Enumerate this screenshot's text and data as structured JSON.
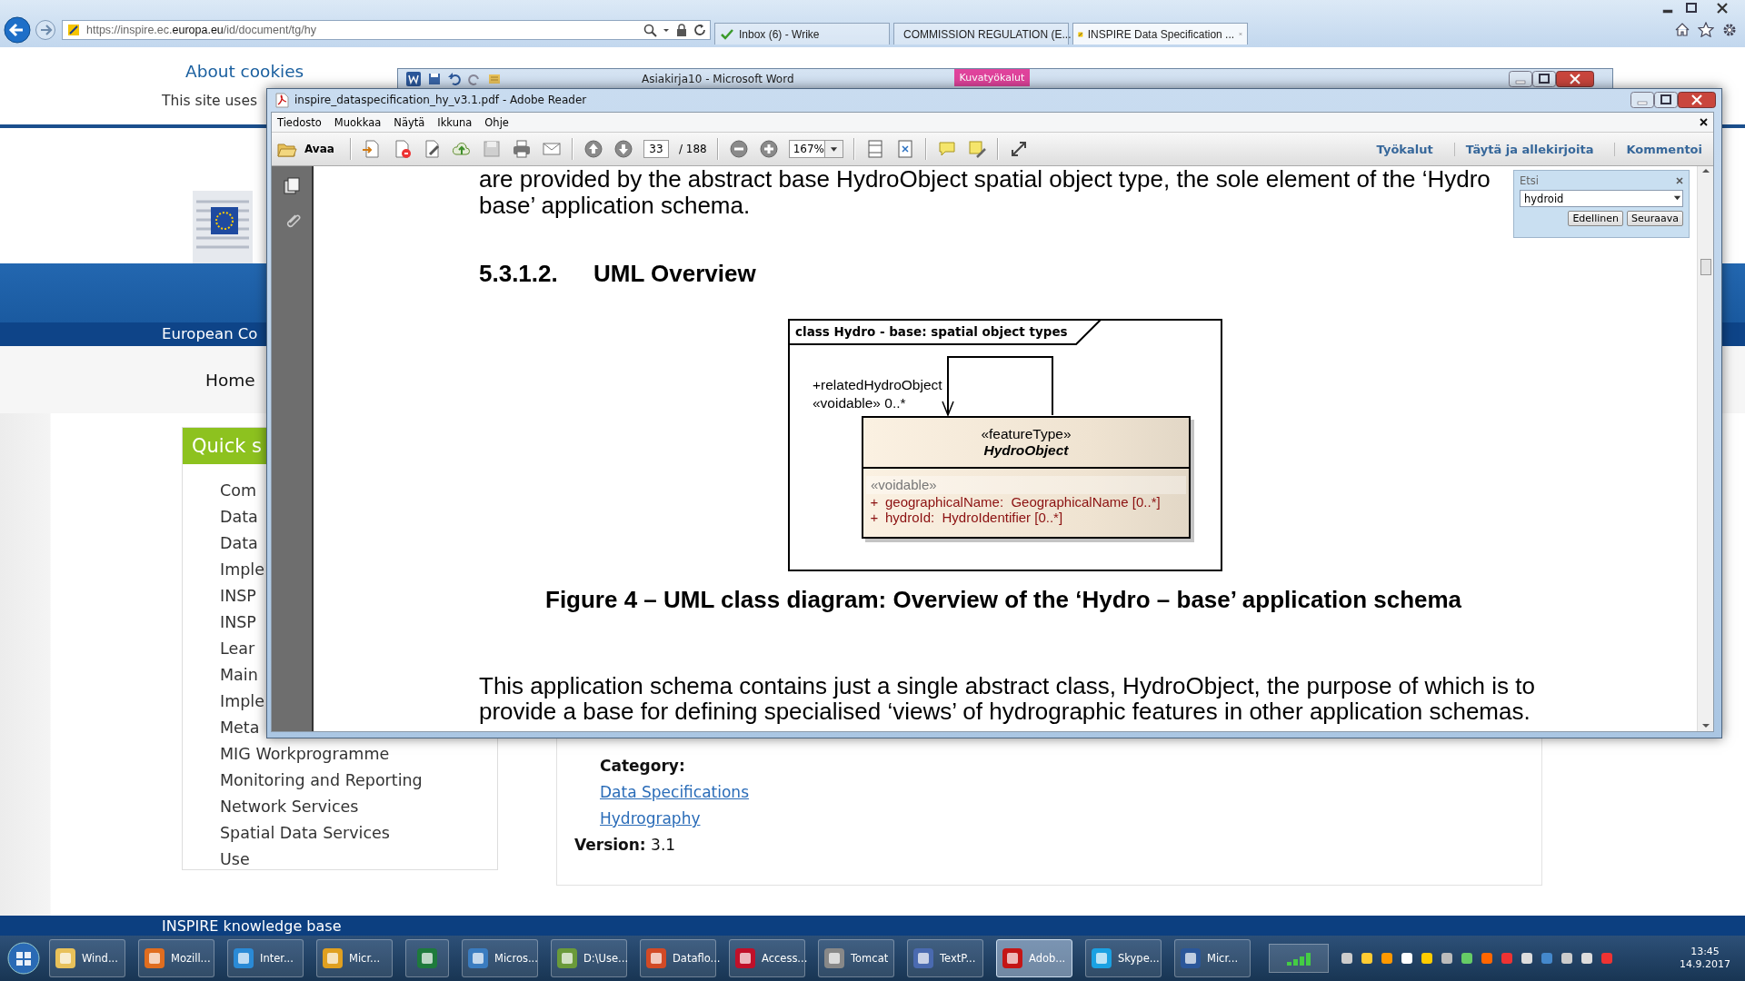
{
  "browser": {
    "address": "https://inspire.ec.**europa.eu**/id/document/tg/hy",
    "tabs": [
      {
        "label": "Inbox (6) - Wrike",
        "selected": false
      },
      {
        "label": "COMMISSION REGULATION (E...",
        "selected": false
      },
      {
        "label": "INSPIRE Data Specification ...",
        "selected": true
      }
    ]
  },
  "website": {
    "cookies_title": "About cookies",
    "cookies_text": "This site uses",
    "header_title": "European Co",
    "nav": [
      "Home"
    ],
    "quick_search": {
      "title": "Quick s",
      "items": [
        "Com",
        "Data",
        "Data",
        "Imple",
        "INSP",
        "INSP",
        "Lear",
        "Main",
        "Imple",
        "Meta",
        "MIG Workprogramme",
        "Monitoring and Reporting",
        "Network Services",
        "Spatial Data Services",
        "Use"
      ]
    },
    "category_label": "Category:",
    "categories": [
      "Data Specifications",
      "Hydrography"
    ],
    "version": "**Version:** 3.1",
    "footer": "INSPIRE knowledge base"
  },
  "word_window": {
    "title": "Asiakirja10 - Microsoft Word",
    "context_tab": "Kuvatyökalut"
  },
  "reader": {
    "title": "inspire_dataspecification_hy_v3.1.pdf - Adobe Reader",
    "menu": [
      "Tiedosto",
      "Muokkaa",
      "Näytä",
      "Ikkuna",
      "Ohje"
    ],
    "open_label": "Avaa",
    "page": "33",
    "page_count": "/ 188",
    "zoom": "167%",
    "panels": [
      "Työkalut",
      "Täytä ja allekirjoita",
      "Kommentoi"
    ],
    "find": {
      "title": "Etsi",
      "value": "hydroid",
      "buttons": [
        "Edellinen",
        "Seuraava"
      ]
    },
    "document": {
      "intro": [
        "are provided by the abstract base HydroObject spatial object type, the sole element of the ‘Hydro",
        "base’ application schema."
      ],
      "heading_number": "5.3.1.2.",
      "heading": "UML Overview",
      "diagram": {
        "title": "class Hydro - base: spatial object types",
        "role": "+relatedHydroObject",
        "multiplicity": "«voidable» 0..*",
        "stereotype": "«featureType»",
        "class_name": "HydroObject",
        "attribute_stereotype": "«voidable»",
        "attributes": [
          {
            "visibility": "+",
            "text": "geographicalName:  GeographicalName [0..*]"
          },
          {
            "visibility": "+",
            "text": "hydroId:  HydroIdentifier [0..*]"
          }
        ]
      },
      "caption": "Figure 4 – UML class diagram: Overview of the ‘Hydro – base’ application schema",
      "paragraph": [
        "This application schema contains just a single abstract class, HydroObject, the purpose of which is to",
        "provide a base for defining specialised ‘views’ of hydrographic features in other application schemas."
      ]
    }
  },
  "taskbar": {
    "items": [
      {
        "label": "Wind...",
        "selected": false
      },
      {
        "label": "Mozill...",
        "selected": false
      },
      {
        "label": "Inter...",
        "selected": false
      },
      {
        "label": "Micr...",
        "selected": false
      },
      {
        "selected": false
      },
      {
        "label": "Micros...",
        "selected": false
      },
      {
        "label": "D:\\Use...",
        "selected": false
      },
      {
        "label": "Dataflo...",
        "selected": false
      },
      {
        "label": "Access...",
        "selected": false
      },
      {
        "label": "Tomcat",
        "selected": false
      },
      {
        "label": "TextP...",
        "selected": false
      },
      {
        "label": "Adob...",
        "selected": true
      },
      {
        "label": "Skype...",
        "selected": false
      },
      {
        "label": "Micr...",
        "selected": false
      }
    ],
    "time": "13:45",
    "date": "14.9.2017"
  }
}
